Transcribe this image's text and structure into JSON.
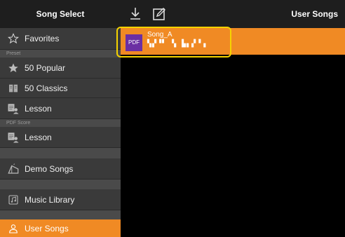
{
  "header": {
    "left_title": "Song Select",
    "right_title": "User Songs",
    "download_icon": "download-icon",
    "edit_icon": "edit-icon"
  },
  "sidebar": {
    "favorites": "Favorites",
    "section_preset": "Preset",
    "popular": "50 Popular",
    "classics": "50 Classics",
    "lesson_preset": "Lesson",
    "section_pdf": "PDF Score",
    "lesson_pdf": "Lesson",
    "demo": "Demo Songs",
    "library": "Music Library",
    "user_songs": "User Songs"
  },
  "songs": [
    {
      "badge": "PDF",
      "name": "Song_A",
      "subtitle": "▚▞▝▘ ▚ ▙▖▞▝▗"
    }
  ],
  "colors": {
    "accent": "#f08a24",
    "highlight": "#f5d300",
    "pdf_badge": "#6b2fa3"
  }
}
